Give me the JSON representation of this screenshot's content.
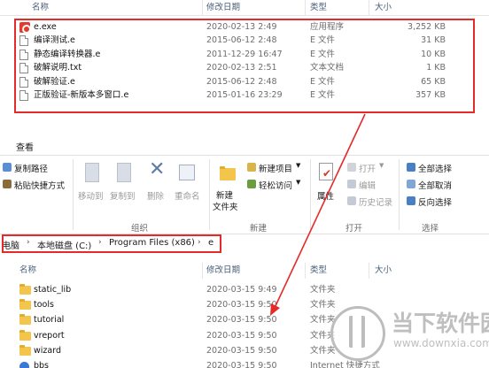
{
  "columns": {
    "name": "名称",
    "date": "修改日期",
    "type": "类型",
    "size": "大小"
  },
  "top_files": [
    {
      "name": "e.exe",
      "date": "2020-02-13 2:49",
      "type": "应用程序",
      "size": "3,252 KB",
      "icon": "exe-icon"
    },
    {
      "name": "编译测试.e",
      "date": "2015-06-12 2:48",
      "type": "E 文件",
      "size": "31 KB",
      "icon": "e-file-icon"
    },
    {
      "name": "静态编译转换器.e",
      "date": "2011-12-29 16:47",
      "type": "E 文件",
      "size": "10 KB",
      "icon": "e-file-icon"
    },
    {
      "name": "破解说明.txt",
      "date": "2020-02-13 2:51",
      "type": "文本文档",
      "size": "1 KB",
      "icon": "text-file-icon"
    },
    {
      "name": "破解验证.e",
      "date": "2015-06-12 2:48",
      "type": "E 文件",
      "size": "65 KB",
      "icon": "e-file-icon"
    },
    {
      "name": "正版验证-新版本多窗口.e",
      "date": "2015-01-16 23:29",
      "type": "E 文件",
      "size": "357 KB",
      "icon": "e-file-icon"
    }
  ],
  "ribbon": {
    "tab": "查看",
    "clipboard": {
      "copy_path": "复制路径",
      "paste_shortcut": "粘贴快捷方式"
    },
    "organize": {
      "move_to": "移动到",
      "copy_to": "复制到",
      "delete": "删除",
      "rename": "重命名",
      "label": "组织"
    },
    "new": {
      "new_folder_line1": "新建",
      "new_folder_line2": "文件夹",
      "new_item": "新建项目",
      "easy_access": "轻松访问",
      "label": "新建"
    },
    "open": {
      "properties": "属性",
      "open": "打开",
      "edit": "编辑",
      "history": "历史记录",
      "label": "打开"
    },
    "select": {
      "select_all": "全部选择",
      "select_none": "全部取消",
      "invert": "反向选择",
      "label": "选择"
    }
  },
  "address": {
    "crumbs": [
      "此电脑",
      "本地磁盘 (C:)",
      "Program Files (x86)",
      "e"
    ],
    "visible_first": "电脑"
  },
  "bottom_files": [
    {
      "name": "static_lib",
      "date": "2020-03-15 9:49",
      "type": "文件夹"
    },
    {
      "name": "tools",
      "date": "2020-03-15 9:50",
      "type": "文件夹"
    },
    {
      "name": "tutorial",
      "date": "2020-03-15 9:50",
      "type": "文件夹"
    },
    {
      "name": "vreport",
      "date": "2020-03-15 9:50",
      "type": "文件夹"
    },
    {
      "name": "wizard",
      "date": "2020-03-15 9:50",
      "type": "文件夹"
    },
    {
      "name": "bbs",
      "date": "2020-03-15 9:50",
      "type": "Internet 快捷方式"
    }
  ],
  "watermark": {
    "brand": "当下软件园",
    "url": "www.downxia.com"
  },
  "colors": {
    "highlight_red": "#e52a2a",
    "header_text": "#4c607a",
    "folder": "#f3c54b"
  }
}
